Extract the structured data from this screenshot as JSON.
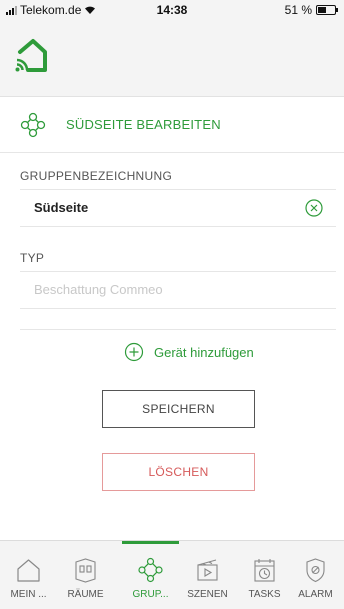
{
  "status_bar": {
    "carrier": "Telekom.de",
    "time": "14:38",
    "battery": "51 %",
    "battery_level": 0.51
  },
  "header": {
    "logo": "home-wifi-logo"
  },
  "page": {
    "title": "SÜDSEITE BEARBEITEN",
    "title_icon": "group-icon"
  },
  "form": {
    "name_label": "GRUPPENBEZEICHNUNG",
    "name_value": "Südseite",
    "type_label": "TYP",
    "type_value": "Beschattung Commeo"
  },
  "actions": {
    "add_device": "Gerät hinzufügen",
    "save": "SPEICHERN",
    "delete": "LÖSCHEN"
  },
  "tabs": [
    {
      "label": "MEIN ...",
      "icon": "home-icon",
      "active": false
    },
    {
      "label": "RÄUME",
      "icon": "rooms-icon",
      "active": false
    },
    {
      "label": "GRUP...",
      "icon": "group-icon",
      "active": true
    },
    {
      "label": "SZENEN",
      "icon": "scenes-icon",
      "active": false
    },
    {
      "label": "TASKS",
      "icon": "tasks-icon",
      "active": false
    },
    {
      "label": "ALARM",
      "icon": "alarm-icon",
      "active": false
    }
  ],
  "colors": {
    "accent": "#2e9b3a",
    "danger": "#d65a5a"
  }
}
